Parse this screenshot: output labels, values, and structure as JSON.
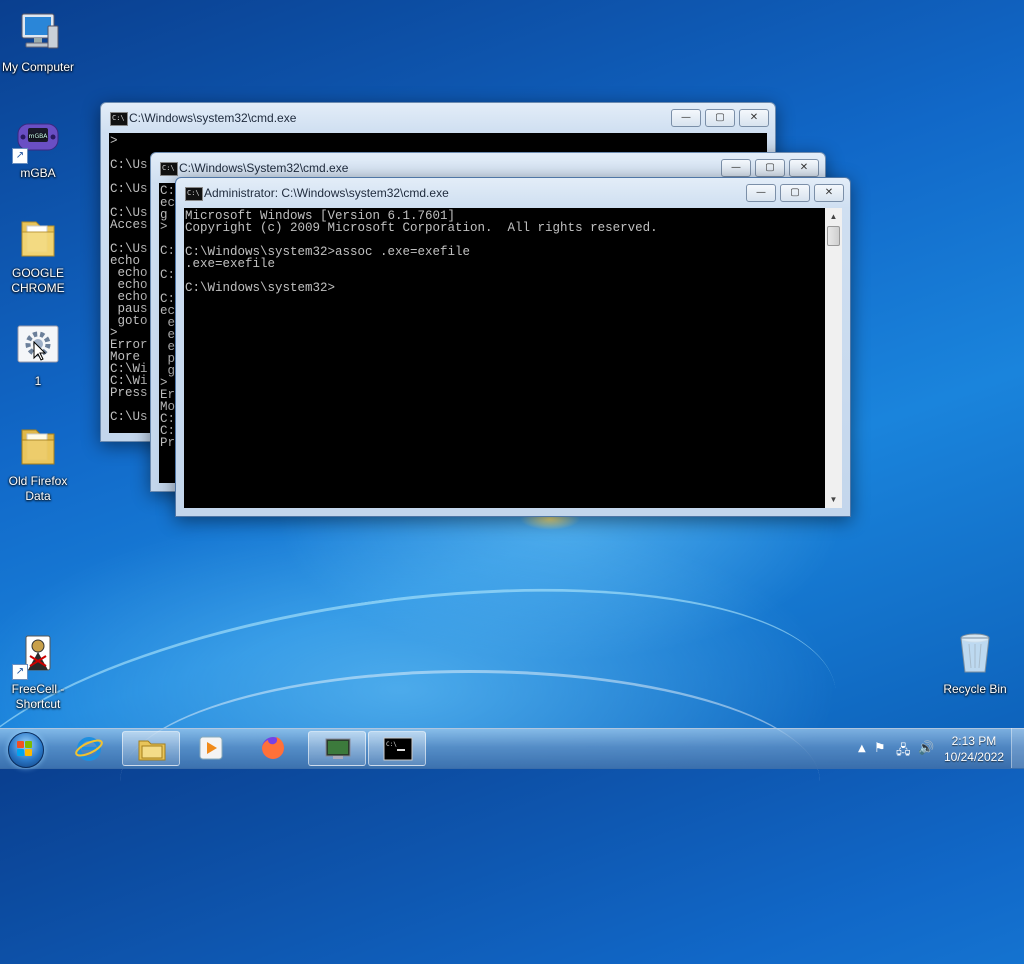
{
  "desktop": {
    "icons": [
      {
        "label": "My Computer",
        "icon": "computer-icon"
      },
      {
        "label": "mGBA",
        "icon": "gameboy-icon"
      },
      {
        "label": "GOOGLE CHROME",
        "icon": "folder-icon"
      },
      {
        "label": "1",
        "icon": "gear-icon"
      },
      {
        "label": "Old Firefox Data",
        "icon": "folder-icon"
      },
      {
        "label": "FreeCell - Shortcut",
        "icon": "freecell-icon"
      },
      {
        "label": "Recycle Bin",
        "icon": "recycle-bin-icon"
      }
    ]
  },
  "windows": {
    "back": {
      "title": "C:\\Windows\\system32\\cmd.exe",
      "console": ">\n\nC:\\Us\n\nC:\\Us\n\nC:\\Us\nAcces\n\nC:\\Us\necho\n echo\n echo\n echo\n paus\n goto\n>\nError\nMore\nC:\\Wi\nC:\\Wi\nPress\n\nC:\\Us"
    },
    "middle": {
      "title": "C:\\Windows\\System32\\cmd.exe",
      "console": "C:\nec\ng\n>\n\nC:\n\nC:\n\nC:\nec\n e\n e\n e\n p\n g\n>\nEr\nMo\nC:\nC:\nPr"
    },
    "front": {
      "title": "Administrator: C:\\Windows\\system32\\cmd.exe",
      "console": "Microsoft Windows [Version 6.1.7601]\nCopyright (c) 2009 Microsoft Corporation.  All rights reserved.\n\nC:\\Windows\\system32>assoc .exe=exefile\n.exe=exefile\n\nC:\\Windows\\system32>"
    },
    "controls": {
      "minimize": "—",
      "maximize": "▢",
      "close": "✕"
    }
  },
  "taskbar": {
    "pinned": [
      {
        "name": "internet-explorer-icon"
      },
      {
        "name": "file-explorer-icon"
      },
      {
        "name": "media-player-icon"
      },
      {
        "name": "firefox-icon"
      },
      {
        "name": "remote-desktop-icon"
      },
      {
        "name": "command-prompt-icon"
      }
    ],
    "tray": {
      "time": "2:13 PM",
      "date": "10/24/2022",
      "overflow": "▲",
      "flag": "⚑",
      "network": "🖧",
      "volume": "🔊"
    }
  },
  "colors": {
    "console_bg": "#000000",
    "console_fg": "#c0c0c0",
    "desktop": "#1168c8"
  }
}
